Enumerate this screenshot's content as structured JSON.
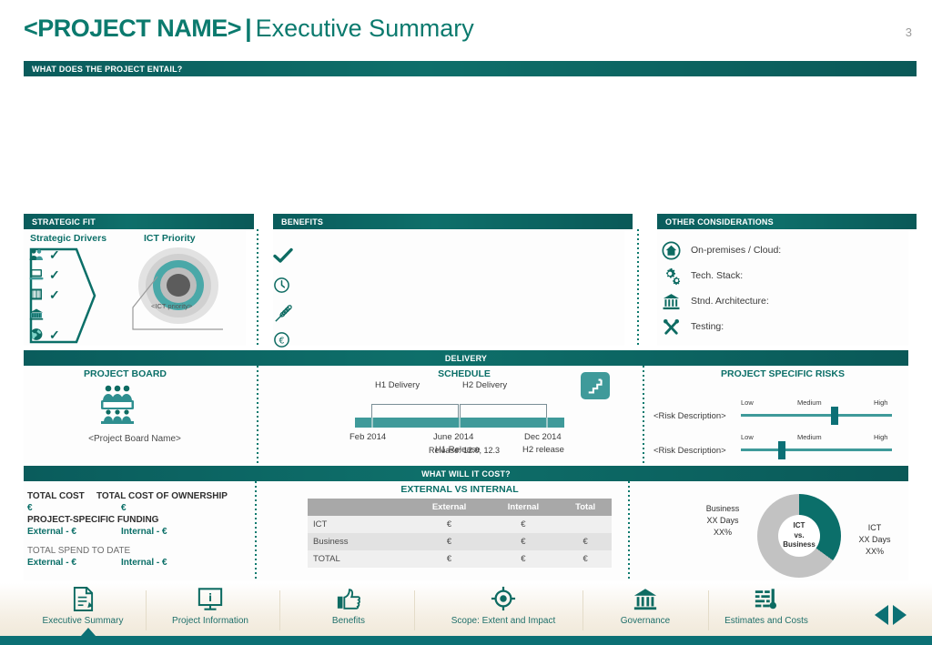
{
  "header": {
    "project_name": "<PROJECT NAME>",
    "separator": "|",
    "subtitle": "Executive Summary",
    "page_number": "3"
  },
  "entail": {
    "title": "WHAT DOES THE PROJECT ENTAIL?"
  },
  "strategic_fit": {
    "title": "STRATEGIC FIT",
    "drivers_heading": "Strategic Drivers",
    "priority_heading": "ICT Priority",
    "drivers": [
      {
        "icon": "people-icon",
        "checked": true
      },
      {
        "icon": "laptop-icon",
        "checked": true
      },
      {
        "icon": "document-barcode-icon",
        "checked": true
      },
      {
        "icon": "bank-building-icon",
        "checked": false
      },
      {
        "icon": "globe-icon",
        "checked": true
      }
    ],
    "priority_label": "<ICT priority>"
  },
  "benefits": {
    "title": "BENEFITS",
    "items": [
      {
        "icon": "check-icon",
        "text": ""
      },
      {
        "icon": "clock-icon",
        "text": ""
      },
      {
        "icon": "wheat-icon",
        "text": ""
      },
      {
        "icon": "euro-circle-icon",
        "text": ""
      }
    ]
  },
  "other_considerations": {
    "title": "OTHER CONSIDERATIONS",
    "items": [
      {
        "icon": "home-icon",
        "label": "On-premises / Cloud:"
      },
      {
        "icon": "gears-icon",
        "label": "Tech. Stack:"
      },
      {
        "icon": "bank-icon",
        "label": "Stnd. Architecture:"
      },
      {
        "icon": "tools-icon",
        "label": "Testing:"
      }
    ]
  },
  "delivery": {
    "title": "DELIVERY",
    "project_board": {
      "heading": "PROJECT BOARD",
      "icon": "board-members-icon",
      "name": "<Project Board Name>"
    },
    "schedule": {
      "heading": "SCHEDULE",
      "icon": "steps-icon",
      "phases": [
        {
          "label": "H1 Delivery",
          "start_pct": 8,
          "end_pct": 50
        },
        {
          "label": "H2 Delivery",
          "start_pct": 50,
          "end_pct": 92
        }
      ],
      "milestones": [
        {
          "date": "Feb 2014",
          "event": "",
          "pos_pct": 8
        },
        {
          "date": "June 2014",
          "event": "H1 Release",
          "pos_pct": 50
        },
        {
          "date": "Dec 2014",
          "event": "H2 release",
          "pos_pct": 92
        }
      ],
      "release_note": "Release: 12.0, 12.3"
    },
    "risks": {
      "heading": "PROJECT SPECIFIC RISKS",
      "scale": [
        "Low",
        "Medium",
        "High"
      ],
      "items": [
        {
          "label": "<Risk Description>",
          "value_pct": 62
        },
        {
          "label": "<Risk Description>",
          "value_pct": 27
        }
      ]
    }
  },
  "cost": {
    "title": "WHAT WILL IT COST?",
    "summary": {
      "total_cost_label": "TOTAL COST",
      "total_cost_value": "€",
      "tco_label": "TOTAL COST  OF OWNERSHIP",
      "tco_value": "€",
      "funding_label": "PROJECT-SPECIFIC FUNDING",
      "funding_external": "External - €",
      "funding_internal": "Internal - €",
      "spend_label": "TOTAL SPEND TO DATE",
      "spend_external": "External - €",
      "spend_internal": "Internal - €"
    },
    "table": {
      "heading": "EXTERNAL VS INTERNAL",
      "columns": [
        "",
        "External",
        "Internal",
        "Total"
      ],
      "rows": [
        [
          "ICT",
          "€",
          "€",
          ""
        ],
        [
          "Business",
          "€",
          "€",
          "€"
        ],
        [
          "TOTAL",
          "€",
          "€",
          "€"
        ]
      ]
    },
    "donut": {
      "center_line1": "ICT",
      "center_line2": "vs.",
      "center_line3": "Business",
      "segments": [
        {
          "name": "Business",
          "days": "XX Days",
          "percent": "XX%",
          "value_pct": 35,
          "color": "#0b6f6a"
        },
        {
          "name": "ICT",
          "days": "XX Days",
          "percent": "XX%",
          "value_pct": 65,
          "color": "#c2c2c2"
        }
      ]
    }
  },
  "nav": {
    "items": [
      {
        "label": "Executive Summary",
        "icon": "document-pen-icon",
        "active": true
      },
      {
        "label": "Project Information",
        "icon": "monitor-info-icon",
        "active": false
      },
      {
        "label": "Benefits",
        "icon": "thumbs-up-icon",
        "active": false
      },
      {
        "label": "Scope: Extent and Impact",
        "icon": "target-crosshair-icon",
        "active": false
      },
      {
        "label": "Governance",
        "icon": "bank-icon",
        "active": false
      },
      {
        "label": "Estimates and Costs",
        "icon": "bar-chart-icon",
        "active": false
      }
    ],
    "prev_icon": "arrow-left-icon",
    "next_icon": "arrow-right-icon"
  },
  "colors": {
    "primary": "#0b6f68",
    "bar": "#0a5c5c",
    "accent": "#3f9a9a",
    "grey": "#c2c2c2"
  }
}
